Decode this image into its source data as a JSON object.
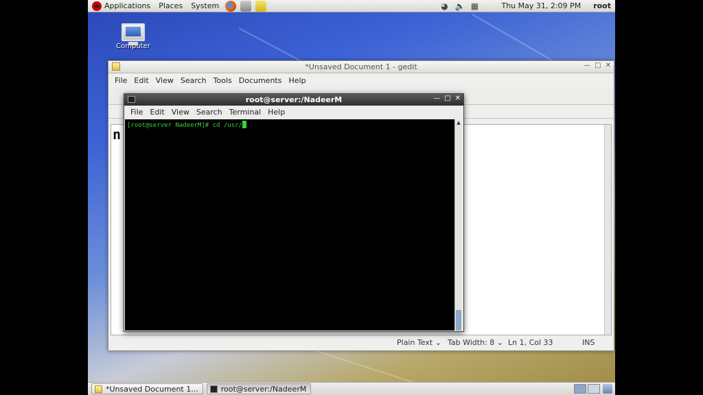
{
  "top_panel": {
    "menus": [
      "Applications",
      "Places",
      "System"
    ],
    "clock": "Thu May 31,  2:09 PM",
    "user": "root"
  },
  "desktop": {
    "icons": [
      {
        "label": "Computer"
      }
    ]
  },
  "gedit": {
    "title": "*Unsaved Document 1 - gedit",
    "menu": [
      "File",
      "Edit",
      "View",
      "Search",
      "Tools",
      "Documents",
      "Help"
    ],
    "editor_text": "n",
    "status": {
      "language": "Plain Text",
      "tab_width": "Tab Width:  8",
      "position": "Ln 1, Col 33",
      "mode": "INS"
    }
  },
  "terminal": {
    "title": "root@server:/NadeerM",
    "menu": [
      "File",
      "Edit",
      "View",
      "Search",
      "Terminal",
      "Help"
    ],
    "prompt": "[root@server NadeerM]# ",
    "command": "cd /usr/"
  },
  "taskbar": {
    "items": [
      {
        "label": "*Unsaved Document 1..."
      },
      {
        "label": "root@server:/NadeerM"
      }
    ]
  }
}
